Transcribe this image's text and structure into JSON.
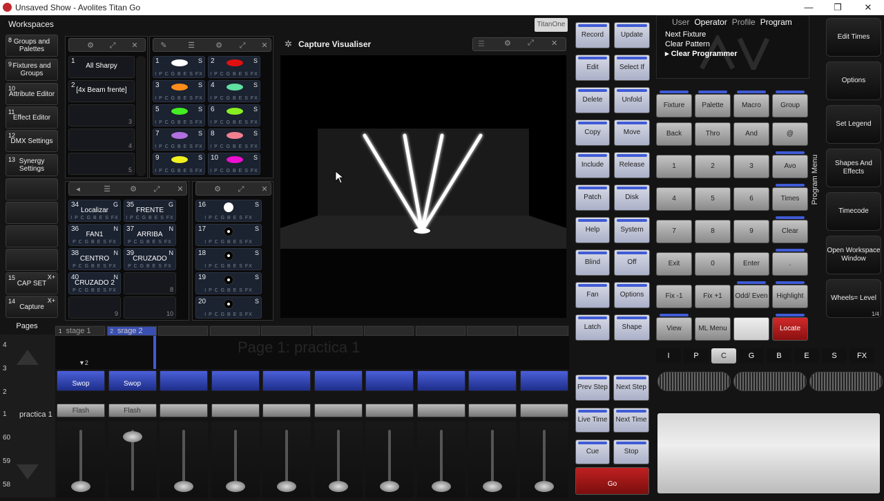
{
  "window": {
    "title": "Unsaved Show - Avolites Titan Go",
    "minimize": "—",
    "restore": "❐",
    "close": "✕"
  },
  "titanone": "TitanOne",
  "workspaces": {
    "title": "Workspaces",
    "items": [
      {
        "num": "8",
        "label": "Groups and Palettes"
      },
      {
        "num": "9",
        "label": "Fixtures and Groups"
      },
      {
        "num": "10",
        "label": "Attribute Editor"
      },
      {
        "num": "11",
        "label": "Effect Editor"
      },
      {
        "num": "12",
        "label": "DMX Settings"
      },
      {
        "num": "13",
        "label": "Synergy Settings"
      },
      {
        "num": "",
        "label": ""
      },
      {
        "num": "",
        "label": ""
      },
      {
        "num": "",
        "label": ""
      },
      {
        "num": "",
        "label": ""
      },
      {
        "num": "15",
        "label": "CAP SET",
        "mark": "X+"
      },
      {
        "num": "14",
        "label": "Capture",
        "mark": "X+"
      }
    ]
  },
  "pages_label": "Pages",
  "groups": [
    {
      "num": "1",
      "label": "All Sharpy"
    },
    {
      "num": "2",
      "label": "[4x Beam frente]"
    },
    {
      "num": "",
      "label": "",
      "slot": "3"
    },
    {
      "num": "",
      "label": "",
      "slot": "4"
    },
    {
      "num": "",
      "label": "",
      "slot": "5"
    }
  ],
  "palettes": [
    {
      "num": "1",
      "type": "S",
      "color": "#ffffff",
      "ipc": "I P C G B E S FX"
    },
    {
      "num": "2",
      "type": "S",
      "color": "#e01010",
      "ipc": "I P C G B E S FX"
    },
    {
      "num": "3",
      "type": "S",
      "color": "#ff8c1a",
      "ipc": "I P C G B E S FX"
    },
    {
      "num": "4",
      "type": "S",
      "color": "#5fe0a0",
      "ipc": "I P C G B E S FX"
    },
    {
      "num": "5",
      "type": "S",
      "color": "#44ee22",
      "ipc": "I P C G B E S FX"
    },
    {
      "num": "6",
      "type": "S",
      "color": "#88ee22",
      "ipc": "I P C G B E S FX"
    },
    {
      "num": "7",
      "type": "S",
      "color": "#b070e0",
      "ipc": "I P C G B E S FX"
    },
    {
      "num": "8",
      "type": "S",
      "color": "#f08090",
      "ipc": "I P C G B E S FX"
    },
    {
      "num": "9",
      "type": "S",
      "color": "#f0f020",
      "ipc": "I P C G B E S FX"
    },
    {
      "num": "10",
      "type": "S",
      "color": "#ee10d0",
      "ipc": "I P C G B E S FX"
    }
  ],
  "positions": [
    {
      "num": "34",
      "label": "Localizar",
      "type": "G",
      "ipc": "I P C G B E S FX"
    },
    {
      "num": "35",
      "label": "FRENTE",
      "type": "G",
      "ipc": "I P C G B E S FX"
    },
    {
      "num": "36",
      "label": "FAN1",
      "type": "N",
      "ipc": "P C G B E S FX"
    },
    {
      "num": "37",
      "label": "ARRIBA",
      "type": "N",
      "ipc": "P C G B E S FX"
    },
    {
      "num": "38",
      "label": "CENTRO",
      "type": "N",
      "ipc": "P C G B E S FX"
    },
    {
      "num": "39",
      "label": "CRUZADO",
      "type": "N",
      "ipc": "P C G B E S FX"
    },
    {
      "num": "40",
      "label": "CRUZADO 2",
      "type": "N",
      "ipc": "P C G B E S FX"
    },
    {
      "num": "",
      "label": "",
      "slot": "8"
    },
    {
      "num": "",
      "label": "",
      "slot": "9"
    },
    {
      "num": "",
      "label": "",
      "slot": "10"
    }
  ],
  "gobos": [
    {
      "num": "16",
      "type": "S",
      "ipc": "I P C G B E S FX"
    },
    {
      "num": "17",
      "type": "S",
      "ipc": "I P C G B E S FX"
    },
    {
      "num": "18",
      "type": "S",
      "ipc": "I P C G B E S FX"
    },
    {
      "num": "19",
      "type": "S",
      "ipc": "I P C G B E S FX"
    },
    {
      "num": "20",
      "type": "S",
      "ipc": "I P C G B E S FX"
    }
  ],
  "visualiser": {
    "title": "Capture Visualiser"
  },
  "program": {
    "col1": [
      "Record",
      "Edit",
      "Delete",
      "Copy",
      "Include",
      "Patch",
      "Help",
      "Blind",
      "Fan",
      "Latch"
    ],
    "col2": [
      "Update",
      "Select If",
      "Unfold",
      "Move",
      "Release",
      "Disk",
      "System",
      "Off",
      "Options",
      "Shape"
    ]
  },
  "menu_header": {
    "items": [
      "User",
      "Operator",
      "Profile",
      "Program"
    ],
    "lines": [
      "Next Fixture",
      "Clear Pattern",
      "Clear Programmer"
    ]
  },
  "keypad": {
    "row1": [
      "Fixture",
      "Palette",
      "Macro",
      "Group"
    ],
    "row2": [
      "Back",
      "Thro",
      "And",
      "@"
    ],
    "row3": [
      "1",
      "2",
      "3",
      "Avo"
    ],
    "row4": [
      "4",
      "5",
      "6",
      "Times"
    ],
    "row5": [
      "7",
      "8",
      "9",
      "Clear"
    ],
    "row6": [
      "Exit",
      "0",
      "Enter",
      "."
    ],
    "row7": [
      "Fix -1",
      "Fix +1",
      "Odd/ Even",
      "Highlight"
    ],
    "row8": [
      "View",
      "ML Menu",
      "",
      "Locate"
    ]
  },
  "program_menu_label": "Program Menu",
  "softkeys": [
    "Edit Times",
    "Options",
    "Set Legend",
    "Shapes And Effects",
    "Timecode",
    "Open Workspace Window",
    "Wheels= Level"
  ],
  "softkey_page": "1/4",
  "attrs": [
    "I",
    "P",
    "C",
    "G",
    "B",
    "E",
    "S",
    "FX"
  ],
  "playback": {
    "tabs": [
      "stage 1",
      "srage 2"
    ],
    "tab_nums": [
      "1",
      "2"
    ],
    "ghost_title": "Page 1: practica 1",
    "page_labels": [
      "4",
      "3",
      "2",
      "1",
      "60",
      "59",
      "58"
    ],
    "page_name": "practica 1",
    "marker": "2",
    "swop": [
      "Swop",
      "Swop",
      "",
      "",
      "",
      "",
      "",
      "",
      "",
      ""
    ],
    "flash": [
      "Flash",
      "Flash",
      "",
      "",
      "",
      "",
      "",
      "",
      "",
      ""
    ],
    "levels": [
      0,
      0.8,
      0,
      0,
      0,
      0,
      0,
      0,
      0,
      0
    ]
  },
  "cue": {
    "prev": "Prev Step",
    "next_step": "Next Step",
    "live": "Live Time",
    "next_time": "Next Time",
    "cue": "Cue",
    "stop": "Stop",
    "go": "Go"
  }
}
